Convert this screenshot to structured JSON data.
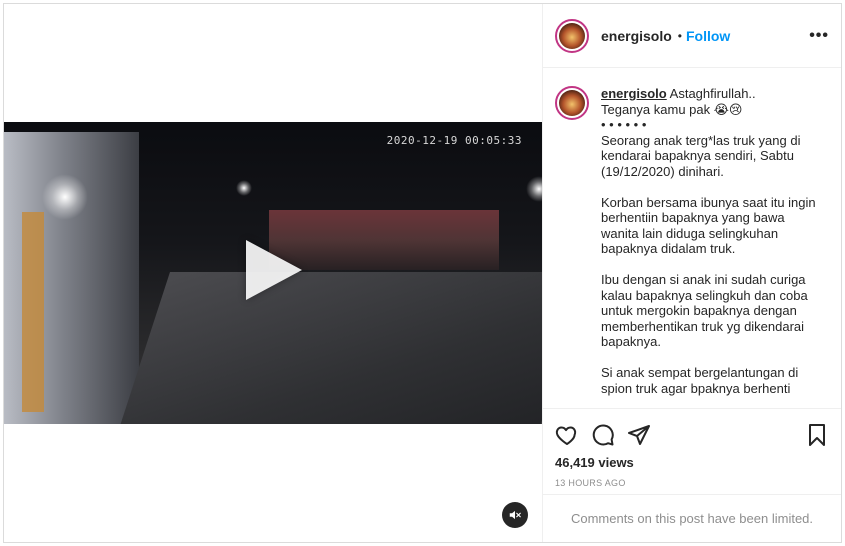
{
  "post": {
    "username": "energisolo",
    "dot": "•",
    "follow_label": "Follow",
    "more_label": "•••"
  },
  "video": {
    "timestamp": "2020-12-19 00:05:33",
    "play_icon": "play-icon",
    "mute_icon": "speaker-muted-icon"
  },
  "caption": {
    "username": "energisolo",
    "text": "Astaghfirullah..\nTeganya kamu pak 😭😢\n• • • • • •\nSeorang anak terg*las truk yang di kendarai bapaknya sendiri, Sabtu (19/12/2020) dinihari.\n\nKorban bersama ibunya saat itu ingin berhentiin bapaknya yang bawa wanita lain diduga selingkuhan bapaknya didalam truk.\n\nIbu dengan si anak ini sudah curiga kalau bapaknya selingkuh dan coba untuk mergokin bapaknya dengan memberhentikan truk yg dikendarai bapaknya.\n\nSi anak sempat bergelantungan di spion truk agar bpaknya berhenti"
  },
  "actions": {
    "like_icon": "heart-icon",
    "comment_icon": "comment-icon",
    "share_icon": "share-icon",
    "save_icon": "bookmark-icon",
    "views": "46,419 views",
    "time_ago": "13 HOURS AGO"
  },
  "comments_notice": "Comments on this post have been limited.",
  "colors": {
    "link_blue": "#0095f6",
    "muted_text": "#8e8e8e",
    "border": "#dbdbdb"
  }
}
